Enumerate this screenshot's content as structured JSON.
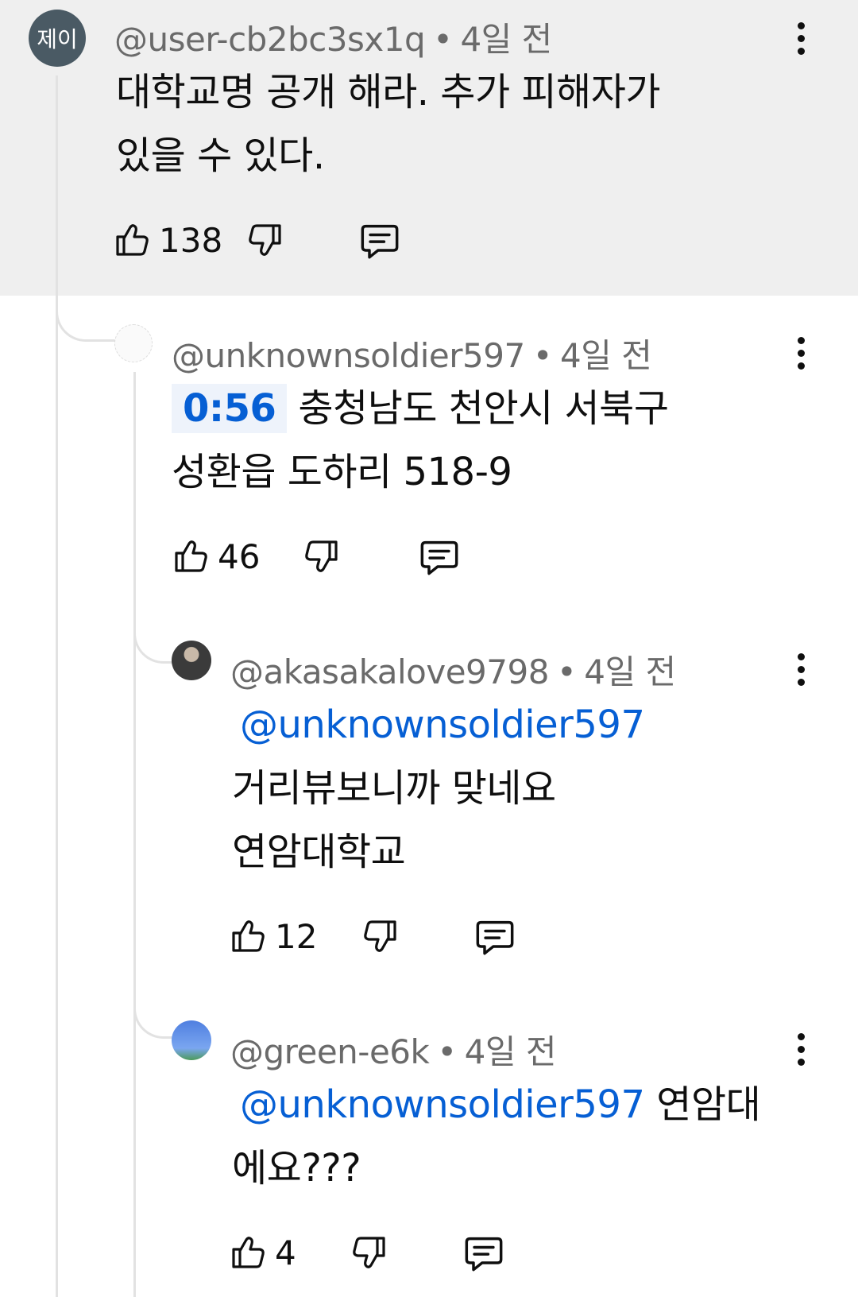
{
  "comments": [
    {
      "avatar_text": "제이",
      "avatar_color": "#4a5a64",
      "author": "@user-cb2bc3sx1q",
      "time": "4일 전",
      "lines": [
        "대학교명 공개 해라.  추가 피해자가",
        "있을 수 있다."
      ],
      "likes": "138"
    },
    {
      "author": "@unknownsoldier597",
      "time": "4일 전",
      "timestamp": "0:56",
      "line1_rest": "충청남도 천안시 서북구",
      "line2": "성환읍 도하리 518-9",
      "likes": "46"
    },
    {
      "author": "@akasakalove9798",
      "time": "4일 전",
      "mention": "@unknownsoldier597",
      "lines": [
        "거리뷰보니까 맞네요",
        "연암대학교"
      ],
      "likes": "12"
    },
    {
      "author": "@green-e6k",
      "time": "4일 전",
      "mention": "@unknownsoldier597",
      "line1_rest": "연암대",
      "line2": "에요???",
      "likes": "4"
    }
  ],
  "icons": {
    "like": "thumbs-up-icon",
    "dislike": "thumbs-down-icon",
    "reply": "reply-comment-icon",
    "menu": "more-vert-icon"
  },
  "colors": {
    "highlight_bg": "#efefef",
    "link": "#065fd4",
    "meta": "#6a6a6a"
  }
}
